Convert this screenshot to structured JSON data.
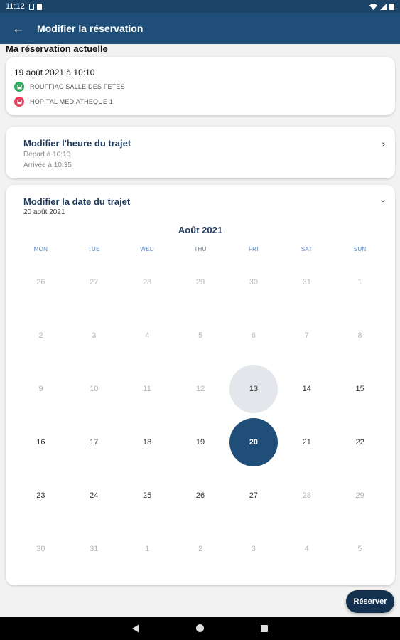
{
  "status_bar": {
    "time": "11:12"
  },
  "app_bar": {
    "back_icon": "arrow-left-icon",
    "title": "Modifier la réservation"
  },
  "current_reservation": {
    "section_title": "Ma réservation actuelle",
    "datetime": "19 août 2021 à 10:10",
    "from": "ROUFFIAC SALLE DES FETES",
    "to": "HOPITAL MEDIATHEQUE 1",
    "from_color": "#2faa5f",
    "to_color": "#e53d5a"
  },
  "time_card": {
    "title": "Modifier l'heure du trajet",
    "departure": "Départ à 10:10",
    "arrival": "Arrivée à 10:35"
  },
  "date_card": {
    "title": "Modifier la date du trajet",
    "selected_date": "20 août 2021",
    "calendar": {
      "month": "Août 2021",
      "weekdays": [
        "MON",
        "TUE",
        "WED",
        "THU",
        "FRI",
        "SAT",
        "SUN"
      ],
      "weeks": [
        [
          "26",
          "27",
          "28",
          "29",
          "30",
          "31",
          "1"
        ],
        [
          "2",
          "3",
          "4",
          "5",
          "6",
          "7",
          "8"
        ],
        [
          "9",
          "10",
          "11",
          "12",
          "13",
          "14",
          "15"
        ],
        [
          "16",
          "17",
          "18",
          "19",
          "20",
          "21",
          "22"
        ],
        [
          "23",
          "24",
          "25",
          "26",
          "27",
          "28",
          "29"
        ],
        [
          "30",
          "31",
          "1",
          "2",
          "3",
          "4",
          "5"
        ]
      ],
      "today": "13",
      "selected": "20"
    }
  },
  "actions": {
    "reserve_label": "Réserver"
  },
  "colors": {
    "primary": "#1f4f78",
    "button": "#14304f",
    "weekday": "#5a86c0"
  }
}
